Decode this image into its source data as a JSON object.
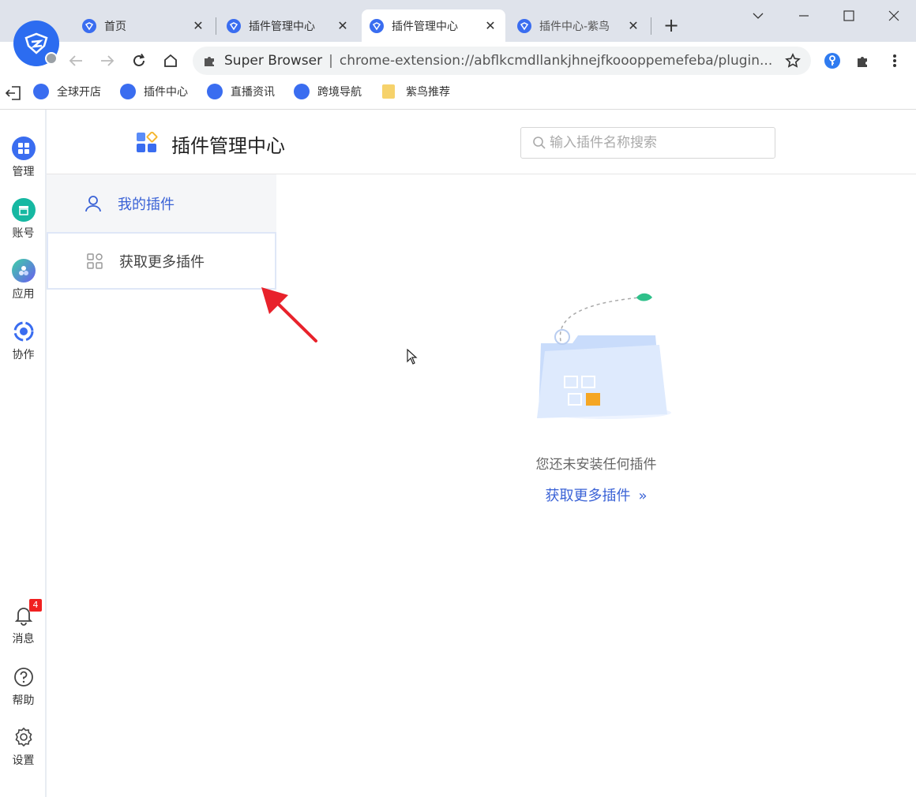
{
  "tabs": [
    {
      "label": "首页",
      "active": false
    },
    {
      "label": "插件管理中心",
      "active": false
    },
    {
      "label": "插件管理中心",
      "active": true
    },
    {
      "label": "插件中心-紫鸟",
      "active": false
    }
  ],
  "address": {
    "site_name": "Super Browser",
    "url": "chrome-extension://abflkcmdllankjhnejfkoooppemefeba/plugin..."
  },
  "bookmarks": [
    {
      "label": "全球开店"
    },
    {
      "label": "插件中心"
    },
    {
      "label": "直播资讯"
    },
    {
      "label": "跨境导航"
    },
    {
      "label": "紫鸟推荐"
    }
  ],
  "sidebar": {
    "items": [
      {
        "label": "管理"
      },
      {
        "label": "账号"
      },
      {
        "label": "应用"
      },
      {
        "label": "协作"
      }
    ],
    "bottom": [
      {
        "label": "消息",
        "badge": "4"
      },
      {
        "label": "帮助"
      },
      {
        "label": "设置"
      }
    ]
  },
  "header": {
    "title": "插件管理中心",
    "search_placeholder": "输入插件名称搜索"
  },
  "nav": {
    "my_plugins": "我的插件",
    "get_more": "获取更多插件"
  },
  "empty": {
    "message": "您还未安装任何插件",
    "link": "获取更多插件"
  },
  "colors": {
    "accent": "#3a62d6",
    "brand": "#2c6cf0",
    "badge": "#f02020",
    "annotation_arrow": "#e8222b"
  }
}
